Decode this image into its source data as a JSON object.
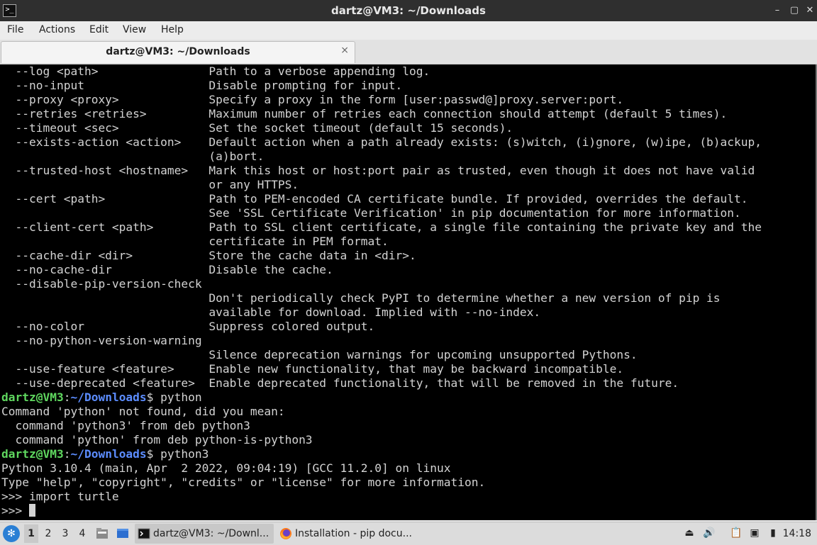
{
  "window": {
    "title": "dartz@VM3: ~/Downloads",
    "minimize_glyph": "–",
    "maximize_glyph": "▢",
    "close_glyph": "✕"
  },
  "menu": {
    "file": "File",
    "actions": "Actions",
    "edit": "Edit",
    "view": "View",
    "help": "Help"
  },
  "tab": {
    "label": "dartz@VM3: ~/Downloads",
    "close_glyph": "⨯"
  },
  "terminal": {
    "prompt_user": "dartz@VM3",
    "prompt_sep": ":",
    "prompt_path": "~/Downloads",
    "prompt_end": "$",
    "help_lines": [
      "  --log <path>                Path to a verbose appending log.",
      "  --no-input                  Disable prompting for input.",
      "  --proxy <proxy>             Specify a proxy in the form [user:passwd@]proxy.server:port.",
      "  --retries <retries>         Maximum number of retries each connection should attempt (default 5 times).",
      "  --timeout <sec>             Set the socket timeout (default 15 seconds).",
      "  --exists-action <action>    Default action when a path already exists: (s)witch, (i)gnore, (w)ipe, (b)ackup,",
      "                              (a)bort.",
      "  --trusted-host <hostname>   Mark this host or host:port pair as trusted, even though it does not have valid",
      "                              or any HTTPS.",
      "  --cert <path>               Path to PEM-encoded CA certificate bundle. If provided, overrides the default.",
      "                              See 'SSL Certificate Verification' in pip documentation for more information.",
      "  --client-cert <path>        Path to SSL client certificate, a single file containing the private key and the",
      "                              certificate in PEM format.",
      "  --cache-dir <dir>           Store the cache data in <dir>.",
      "  --no-cache-dir              Disable the cache.",
      "  --disable-pip-version-check",
      "                              Don't periodically check PyPI to determine whether a new version of pip is",
      "                              available for download. Implied with --no-index.",
      "  --no-color                  Suppress colored output.",
      "  --no-python-version-warning",
      "                              Silence deprecation warnings for upcoming unsupported Pythons.",
      "  --use-feature <feature>     Enable new functionality, that may be backward incompatible.",
      "  --use-deprecated <feature>  Enable deprecated functionality, that will be removed in the future."
    ],
    "cmd1": " python",
    "not_found_lines": [
      "Command 'python' not found, did you mean:",
      "  command 'python3' from deb python3",
      "  command 'python' from deb python-is-python3"
    ],
    "cmd2": " python3",
    "python_lines": [
      "Python 3.10.4 (main, Apr  2 2022, 09:04:19) [GCC 11.2.0] on linux",
      "Type \"help\", \"copyright\", \"credits\" or \"license\" for more information.",
      ">>> import turtle"
    ],
    "repl_prompt": ">>> "
  },
  "taskbar": {
    "workspaces": [
      "1",
      "2",
      "3",
      "4"
    ],
    "active_workspace": "1",
    "tasks": [
      {
        "label": "dartz@VM3: ~/Downl...",
        "icon": "terminal-icon"
      },
      {
        "label": "Installation - pip docu...",
        "icon": "firefox-icon"
      }
    ],
    "clock": "14:18"
  },
  "colors": {
    "prompt_user": "#5fd75f",
    "prompt_path": "#5c8dff",
    "terminal_bg": "#000000",
    "terminal_fg": "#d3d3d3"
  }
}
